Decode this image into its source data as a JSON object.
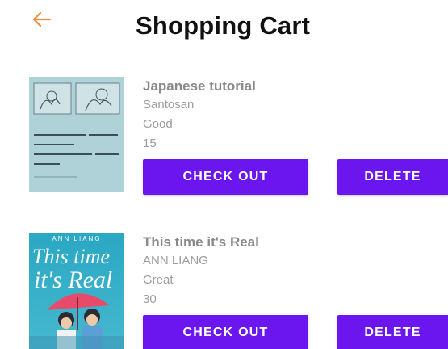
{
  "header": {
    "title": "Shopping Cart",
    "back_icon": "arrow-left-icon",
    "accent_color": "#f08c3c"
  },
  "cart": {
    "items": [
      {
        "title": "Japanese tutorial",
        "author": "Santosan",
        "condition": "Good",
        "price": "15",
        "checkout_label": "CHECK OUT",
        "delete_label": "DELETE",
        "cover_icon": "notebook-photo"
      },
      {
        "title": "This time it's Real",
        "author": "ANN LIANG",
        "condition": "Great",
        "price": "30",
        "checkout_label": "CHECK OUT",
        "delete_label": "DELETE",
        "cover": {
          "top_text": "ANN LIANG",
          "title_line1": "This time",
          "title_line2": "it's Real"
        }
      }
    ]
  },
  "colors": {
    "button": "#6b16ee",
    "item_text": "#8a8a8a"
  }
}
